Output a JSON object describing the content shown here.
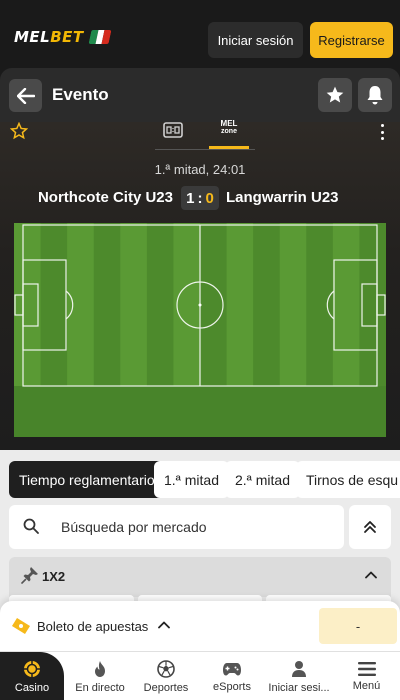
{
  "header": {
    "logo_mel": "MEL",
    "logo_bet": "BET",
    "login_label": "Iniciar sesión",
    "register_label": "Registrarse",
    "colors": {
      "brand": "#f6b91b",
      "dark": "#1a1a1a"
    }
  },
  "event_bar": {
    "title": "Evento",
    "icons": [
      "arrow-left-icon",
      "star-icon",
      "bell-icon"
    ]
  },
  "match": {
    "tabs": {
      "melzone_line1": "MEL",
      "melzone_line2": "zone"
    },
    "period": "1.ª mitad, 24:01",
    "home_team": "Northcote City U23",
    "away_team": "Langwarrin U23",
    "home_score": "1",
    "score_separator": ":",
    "away_score": "0"
  },
  "filters": {
    "items": [
      {
        "label": "Tiempo reglamentario",
        "active": true
      },
      {
        "label": "1.ª mitad",
        "active": false
      },
      {
        "label": "2.ª mitad",
        "active": false
      },
      {
        "label": "Tirnos de esqu",
        "active": false
      }
    ]
  },
  "search": {
    "placeholder": "Búsqueda por mercado"
  },
  "market": {
    "title": "1X2"
  },
  "betslip": {
    "label": "Boleto de apuestas",
    "value": "-"
  },
  "bottom_nav": {
    "items": [
      {
        "label": "Casino",
        "icon": "casino-chip-icon",
        "active": true
      },
      {
        "label": "En directo",
        "icon": "flame-icon"
      },
      {
        "label": "Deportes",
        "icon": "soccer-ball-icon"
      },
      {
        "label": "eSports",
        "icon": "gamepad-icon"
      },
      {
        "label": "Iniciar sesi...",
        "icon": "user-icon"
      },
      {
        "label": "Menú",
        "icon": "hamburger-menu-icon"
      }
    ]
  }
}
